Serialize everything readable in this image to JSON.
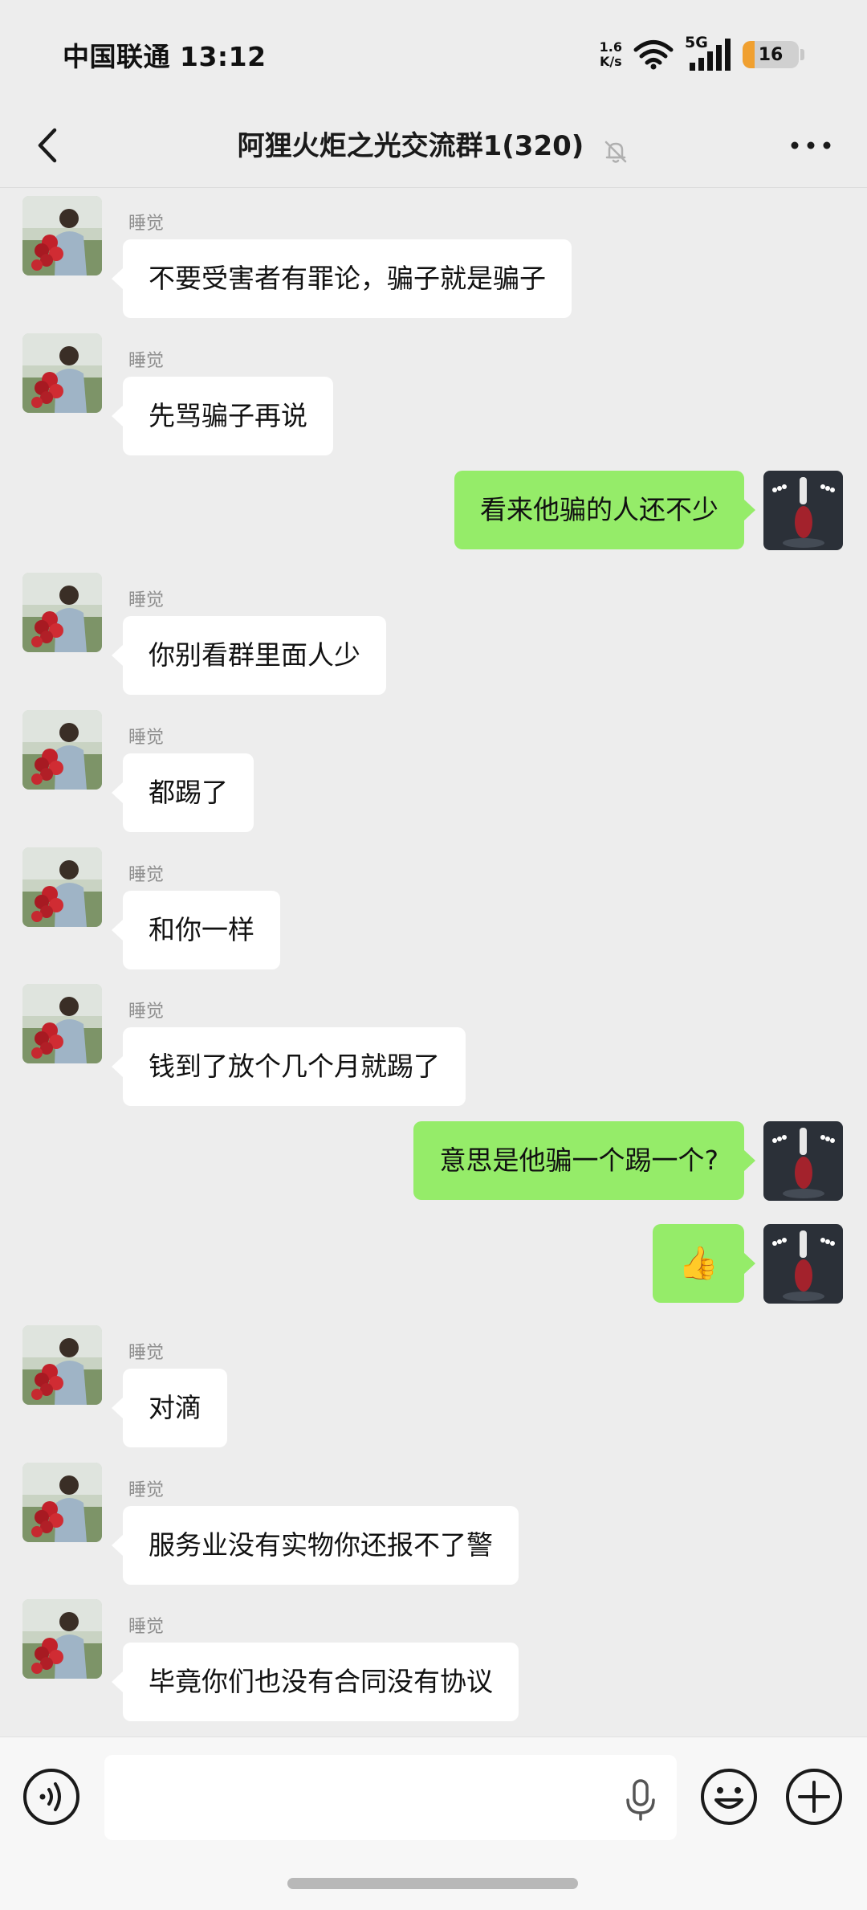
{
  "status_bar": {
    "carrier_time": "中国联通 13:12",
    "net_speed_value": "1.6",
    "net_speed_unit": "K/s",
    "network_type": "5G",
    "battery": "16"
  },
  "header": {
    "title": "阿狸火炬之光交流群1(320)",
    "icons": [
      "back-icon",
      "mute-bell-icon",
      "more-icon"
    ]
  },
  "messages": [
    {
      "side": "in",
      "sender": "睡觉",
      "text": "不要受害者有罪论，骗子就是骗子"
    },
    {
      "side": "in",
      "sender": "睡觉",
      "text": "先骂骗子再说"
    },
    {
      "side": "out",
      "text": "看来他骗的人还不少"
    },
    {
      "side": "in",
      "sender": "睡觉",
      "text": "你别看群里面人少"
    },
    {
      "side": "in",
      "sender": "睡觉",
      "text": "都踢了"
    },
    {
      "side": "in",
      "sender": "睡觉",
      "text": "和你一样"
    },
    {
      "side": "in",
      "sender": "睡觉",
      "text": "钱到了放个几个月就踢了"
    },
    {
      "side": "out",
      "text": "意思是他骗一个踢一个?"
    },
    {
      "side": "out",
      "text": "👍"
    },
    {
      "side": "in",
      "sender": "睡觉",
      "text": "对滴"
    },
    {
      "side": "in",
      "sender": "睡觉",
      "text": "服务业没有实物你还报不了警"
    },
    {
      "side": "in",
      "sender": "睡觉",
      "text": "毕竟你们也没有合同没有协议"
    }
  ],
  "input_bar": {
    "placeholder": "",
    "icons": [
      "voice-icon",
      "mic-icon",
      "emoji-icon",
      "plus-icon"
    ]
  },
  "colors": {
    "background": "#ededed",
    "outgoing_bubble": "#95ec69",
    "incoming_bubble": "#ffffff",
    "battery_fill": "#f0a030"
  }
}
